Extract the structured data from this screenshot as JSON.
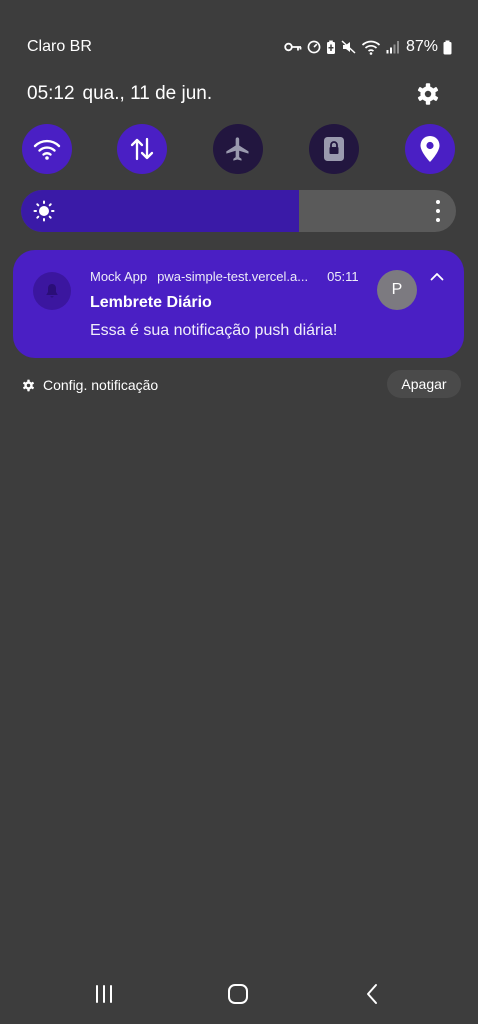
{
  "status_bar": {
    "carrier": "Claro BR",
    "battery_percent": "87%",
    "icons": [
      "key-icon",
      "data-saver-icon",
      "battery-saver-icon",
      "mute-icon",
      "wifi-icon",
      "signal-icon",
      "battery-icon"
    ]
  },
  "header": {
    "time": "05:12",
    "date": "qua., 11 de jun.",
    "settings_icon": "gear-icon"
  },
  "quick_toggles": [
    {
      "name": "wifi",
      "icon": "wifi-icon",
      "active": true
    },
    {
      "name": "mobile-data",
      "icon": "data-transfer-icon",
      "active": true
    },
    {
      "name": "airplane-mode",
      "icon": "airplane-icon",
      "active": false
    },
    {
      "name": "screen-lock",
      "icon": "lock-icon",
      "active": false
    },
    {
      "name": "location",
      "icon": "location-pin-icon",
      "active": true
    }
  ],
  "brightness": {
    "level": 0.64,
    "icon": "sun-icon",
    "more_icon": "more-vertical-icon"
  },
  "notification": {
    "app_name": "Mock App",
    "source": "pwa-simple-test.vercel.a...",
    "time": "05:11",
    "title": "Lembrete Diário",
    "body": "Essa é sua notificação push diária!",
    "avatar_letter": "P",
    "app_icon": "bell-icon",
    "expand_icon": "chevron-up-icon"
  },
  "footer": {
    "settings_label": "Config. notificação",
    "clear_label": "Apagar"
  },
  "nav_bar": {
    "recents_icon": "recents-icon",
    "home_icon": "home-icon",
    "back_icon": "back-icon"
  },
  "colors": {
    "background": "#3d3d3d",
    "accent": "#4a1fc4",
    "toggle_off": "#22163f"
  }
}
